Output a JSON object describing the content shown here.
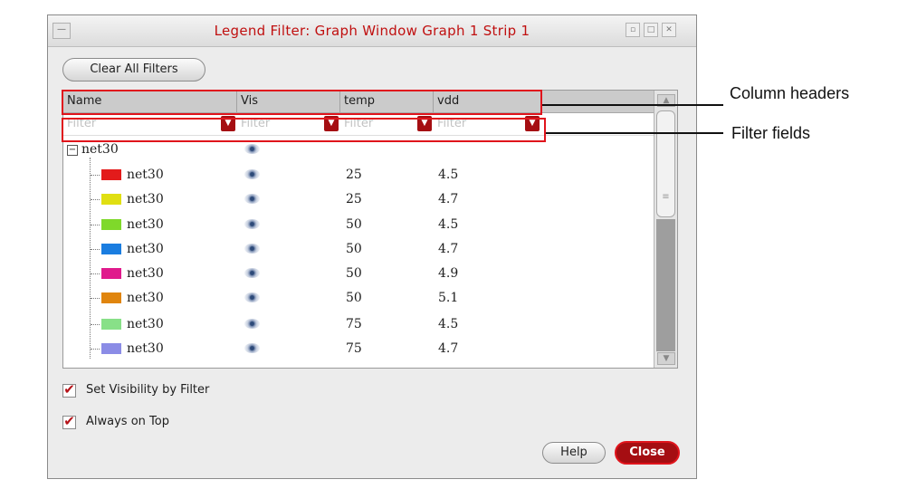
{
  "window": {
    "title": "Legend Filter: Graph Window Graph 1 Strip 1",
    "menu_glyph": "—",
    "minimize_glyph": "▫",
    "maximize_glyph": "□",
    "close_glyph": "✕"
  },
  "toolbar": {
    "clear_label": "Clear All Filters"
  },
  "table": {
    "headers": [
      "Name",
      "Vis",
      "temp",
      "vdd"
    ],
    "filter_placeholder": "Filter",
    "dropdown_glyph": "▼",
    "group": {
      "label": "net30",
      "expander": "−",
      "visible_icon": "eye-icon"
    },
    "rows": [
      {
        "name": "net30",
        "color": "#e31b1b",
        "temp": "25",
        "vdd": "4.5"
      },
      {
        "name": "net30",
        "color": "#e0df12",
        "temp": "25",
        "vdd": "4.7"
      },
      {
        "name": "net30",
        "color": "#7fd92a",
        "temp": "50",
        "vdd": "4.5"
      },
      {
        "name": "net30",
        "color": "#1a7de0",
        "temp": "50",
        "vdd": "4.7"
      },
      {
        "name": "net30",
        "color": "#e01a8c",
        "temp": "50",
        "vdd": "4.9"
      },
      {
        "name": "net30",
        "color": "#e0850e",
        "temp": "50",
        "vdd": "5.1"
      },
      {
        "name": "net30",
        "color": "#88e088",
        "temp": "75",
        "vdd": "4.5"
      },
      {
        "name": "net30",
        "color": "#8b8ce6",
        "temp": "75",
        "vdd": "4.7"
      }
    ]
  },
  "options": {
    "set_visibility_label": "Set Visibility by Filter",
    "set_visibility_checked": true,
    "always_on_top_label": "Always on Top",
    "always_on_top_checked": true,
    "check_glyph": "✔"
  },
  "buttons": {
    "help_label": "Help",
    "close_label": "Close"
  },
  "annotations": {
    "column_headers": "Column headers",
    "filter_fields": "Filter fields"
  },
  "colors": {
    "accent_red": "#a50e12",
    "highlight_red": "#e0141c",
    "title_red": "#c01010"
  }
}
